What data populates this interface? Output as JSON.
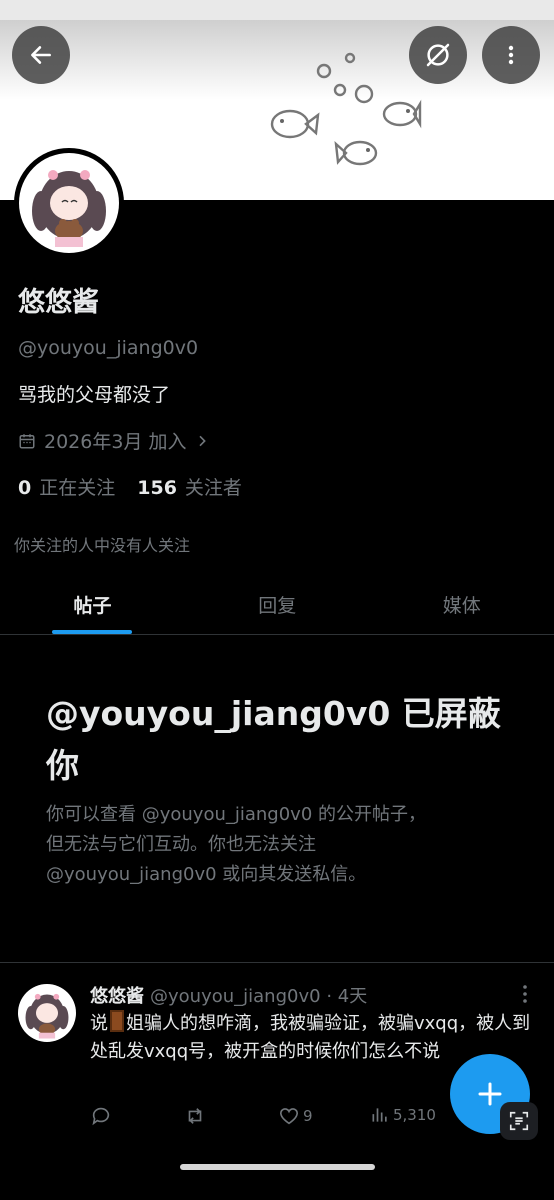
{
  "profile": {
    "name": "悠悠酱",
    "handle": "@youyou_jiang0v0",
    "bio": "骂我的父母都没了",
    "joined": "2026年3月 加入",
    "following_count": "0",
    "following_label": "正在关注",
    "followers_count": "156",
    "followers_label": "关注者",
    "followed_by_note": "你关注的人中没有人关注"
  },
  "tabs": [
    {
      "label": "帖子",
      "active": true
    },
    {
      "label": "回复",
      "active": false
    },
    {
      "label": "媒体",
      "active": false
    }
  ],
  "blocked": {
    "title": "@youyou_jiang0v0 已屏蔽你",
    "body": "你可以查看 @youyou_jiang0v0 的公开帖子，但无法与它们互动。你也无法关注 @youyou_jiang0v0 或向其发送私信。"
  },
  "post": {
    "name": "悠悠酱",
    "handle": "@youyou_jiang0v0",
    "time": "· 4天",
    "text_before": "说",
    "text_after": "姐骗人的想咋滴，我被骗验证，被骗vxqq，被人到处乱发vxqq号，被开盒的时候你们怎么不说",
    "likes": "9",
    "views": "5,310"
  },
  "icons": [
    "back-arrow-icon",
    "translate-icon",
    "more-vertical-icon",
    "calendar-icon",
    "chevron-right-icon",
    "reply-icon",
    "repost-icon",
    "heart-icon",
    "views-icon",
    "plus-icon",
    "lens-icon"
  ],
  "colors": {
    "accent": "#1d9bf0",
    "muted": "#71767b",
    "text": "#e7e9ea",
    "background": "#000000"
  }
}
